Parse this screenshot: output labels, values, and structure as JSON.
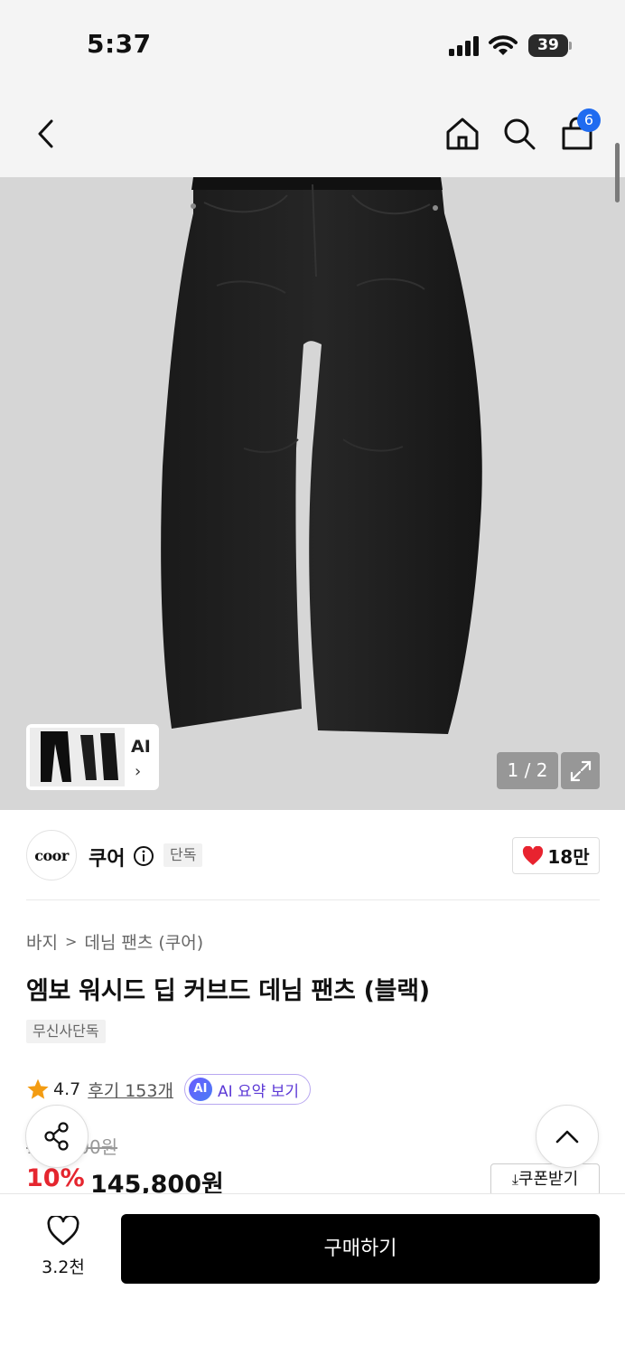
{
  "status_bar": {
    "time": "5:37",
    "battery": "39"
  },
  "nav": {
    "cart_count": "6"
  },
  "gallery": {
    "ai_label": "AI",
    "ai_arrow": "›",
    "pager": "1 / 2"
  },
  "brand": {
    "logo_text": "coor",
    "name": "쿠어",
    "tag": "단독",
    "likes": "18만"
  },
  "breadcrumb": {
    "items": [
      "바지",
      "데님 팬츠 (쿠어)"
    ],
    "separator": ">"
  },
  "product": {
    "title": "엠보 워시드 딥 커브드 데님 팬츠 (블랙)",
    "badge": "무신사단독",
    "rating": "4.7",
    "reviews": "후기 153개",
    "ai_badge": "AI",
    "ai_summary": "AI 요약 보기",
    "original_price": "162,000원",
    "discount": "10%",
    "price": "145,800원",
    "coupon": "쿠폰받기"
  },
  "bottom_bar": {
    "wish_count": "3.2천",
    "buy_label": "구매하기"
  },
  "colors": {
    "accent_blue": "#1f6bf0",
    "discount_red": "#e5262f",
    "heart_red": "#e8232f",
    "buy_black": "#000000"
  }
}
